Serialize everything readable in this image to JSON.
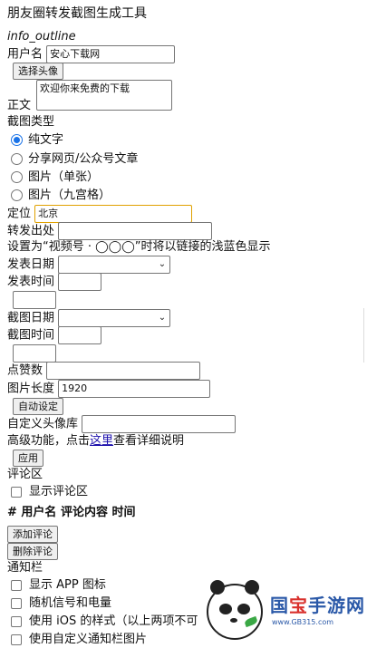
{
  "app": {
    "title": "朋友圈转发截图生成工具"
  },
  "info_icon_text": "info_outline",
  "username": {
    "label": "用户名",
    "value": "安心下载网"
  },
  "avatar_button": "选择头像",
  "content": {
    "label": "正文",
    "value": "欢迎你来免费的下载"
  },
  "screenshot_type": {
    "label": "截图类型",
    "options": [
      {
        "label": "纯文字",
        "checked": true
      },
      {
        "label": "分享网页/公众号文章",
        "checked": false
      },
      {
        "label": "图片（单张）",
        "checked": false
      },
      {
        "label": "图片（九宫格）",
        "checked": false
      }
    ]
  },
  "location": {
    "label": "定位",
    "value": "北京"
  },
  "forward_source": {
    "label": "转发出处",
    "value": ""
  },
  "video_note": "设置为“视频号 · ◯◯◯”时将以链接的浅蓝色显示",
  "publish_date": {
    "label": "发表日期",
    "value": ""
  },
  "publish_time": {
    "label": "发表时间",
    "value": ""
  },
  "screenshot_date": {
    "label": "截图日期",
    "value": ""
  },
  "screenshot_time": {
    "label": "截图时间",
    "value": ""
  },
  "likes": {
    "label": "点赞数",
    "value": ""
  },
  "image_length": {
    "label": "图片长度",
    "value": "1920"
  },
  "auto_set_button": "自动设定",
  "custom_avatar_lib": {
    "label": "自定义头像库",
    "value": ""
  },
  "advanced": {
    "prefix": "高级功能，点击",
    "link": "这里",
    "suffix": "查看详细说明"
  },
  "apply_button": "应用",
  "comments": {
    "label": "评论区",
    "show_label": "显示评论区",
    "header": "# 用户名 评论内容 时间",
    "add_button": "添加评论",
    "delete_button": "删除评论"
  },
  "notification_bar": {
    "label": "通知栏",
    "options": [
      "显示 APP 图标",
      "随机信号和电量",
      "使用 iOS 的样式（以上两项不可",
      "使用自定义通知栏图片"
    ]
  },
  "watermark": {
    "brand_a": "国",
    "brand_b": "宝",
    "brand_c": "手游网",
    "url": "www.GB315.com"
  }
}
